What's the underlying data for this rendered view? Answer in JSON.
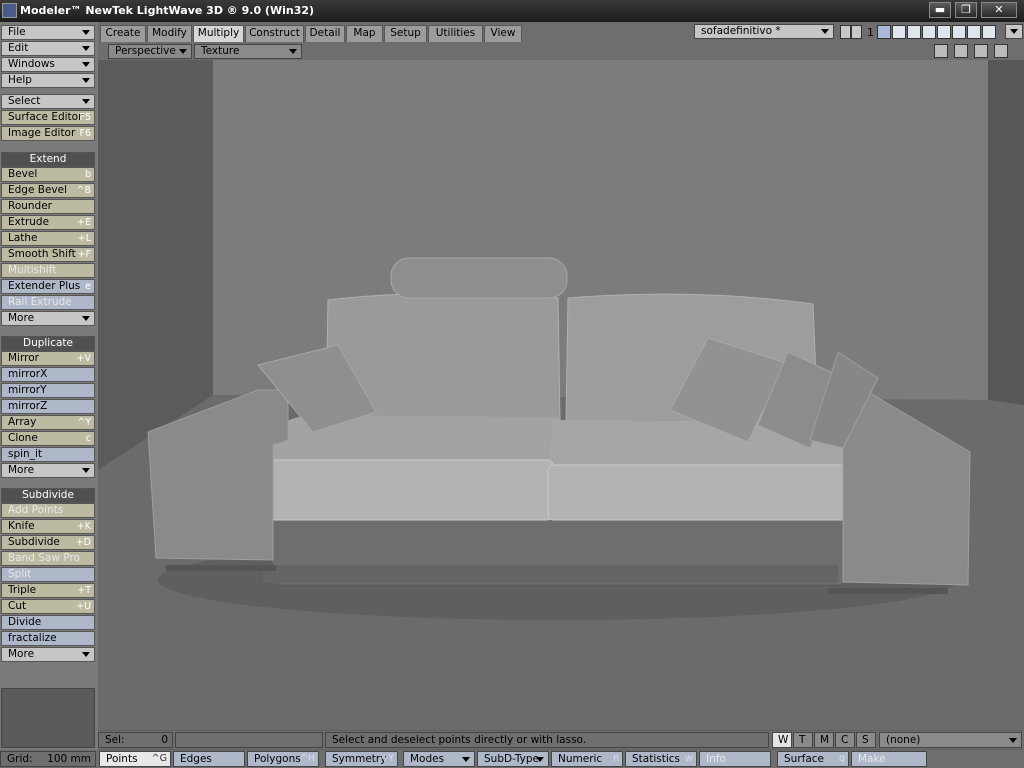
{
  "title": {
    "text": "Modeler™ NewTek LightWave 3D ® 9.0 (Win32)",
    "min": "▬",
    "max": "❐",
    "close": "✕"
  },
  "menus": [
    {
      "label": "File"
    },
    {
      "label": "Edit"
    },
    {
      "label": "Windows"
    },
    {
      "label": "Help"
    }
  ],
  "quick": [
    {
      "label": "Select",
      "sc": ""
    },
    {
      "label": "Surface Editor",
      "sc": "F5"
    },
    {
      "label": "Image Editor",
      "sc": "F6"
    }
  ],
  "extend": {
    "header": "Extend",
    "items": [
      {
        "label": "Bevel",
        "sc": "b"
      },
      {
        "label": "Edge Bevel",
        "sc": "^B"
      },
      {
        "label": "Rounder",
        "sc": ""
      },
      {
        "label": "Extrude",
        "sc": "+E"
      },
      {
        "label": "Lathe",
        "sc": "+L"
      },
      {
        "label": "Smooth Shift",
        "sc": "+F"
      },
      {
        "label": "Multishift",
        "sc": ""
      },
      {
        "label": "Extender Plus",
        "sc": "e"
      },
      {
        "label": "Rail Extrude",
        "sc": ""
      },
      {
        "label": "More",
        "sc": ""
      }
    ]
  },
  "duplicate": {
    "header": "Duplicate",
    "items": [
      {
        "label": "Mirror",
        "sc": "+V"
      },
      {
        "label": "mirrorX",
        "sc": ""
      },
      {
        "label": "mirrorY",
        "sc": ""
      },
      {
        "label": "mirrorZ",
        "sc": ""
      },
      {
        "label": "Array",
        "sc": "^Y"
      },
      {
        "label": "Clone",
        "sc": "c"
      },
      {
        "label": "spin_it",
        "sc": ""
      },
      {
        "label": "More",
        "sc": ""
      }
    ]
  },
  "subdivide": {
    "header": "Subdivide",
    "items": [
      {
        "label": "Add Points",
        "sc": ""
      },
      {
        "label": "Knife",
        "sc": "+K"
      },
      {
        "label": "Subdivide",
        "sc": "+D"
      },
      {
        "label": "Band Saw Pro",
        "sc": ""
      },
      {
        "label": "Split",
        "sc": ""
      },
      {
        "label": "Triple",
        "sc": "+T"
      },
      {
        "label": "Cut",
        "sc": "+U"
      },
      {
        "label": "Divide",
        "sc": ""
      },
      {
        "label": "fractalize",
        "sc": ""
      },
      {
        "label": "More",
        "sc": ""
      }
    ]
  },
  "tabs": [
    {
      "label": "Create"
    },
    {
      "label": "Modify"
    },
    {
      "label": "Multiply"
    },
    {
      "label": "Construct"
    },
    {
      "label": "Detail"
    },
    {
      "label": "Map"
    },
    {
      "label": "Setup"
    },
    {
      "label": "Utilities"
    },
    {
      "label": "View"
    }
  ],
  "object": {
    "name": "sofadefinitivo *",
    "layer": "1"
  },
  "view": {
    "mode": "Perspective",
    "shading": "Texture"
  },
  "status": {
    "sel_label": "Sel:",
    "sel_value": "0",
    "message": "Select and deselect points directly or with lasso.",
    "wtmcs": [
      "W",
      "T",
      "M",
      "C",
      "S"
    ],
    "vmap": "(none)"
  },
  "grid": {
    "label": "Grid:",
    "value": "100 mm"
  },
  "bottombar": [
    {
      "label": "Points",
      "sc": "^G"
    },
    {
      "label": "Edges",
      "sc": ""
    },
    {
      "label": "Polygons",
      "sc": "^H"
    },
    {
      "label": "Symmetry",
      "sc": "+Y"
    },
    {
      "label": "Modes",
      "sc": ""
    },
    {
      "label": "SubD-Type",
      "sc": ""
    },
    {
      "label": "Numeric",
      "sc": "n"
    },
    {
      "label": "Statistics",
      "sc": "w"
    },
    {
      "label": "Info",
      "sc": ""
    },
    {
      "label": "Surface",
      "sc": "q"
    },
    {
      "label": "Make",
      "sc": ""
    }
  ],
  "colors": {
    "panel": "#7a7a7a",
    "button": "#c6c6c6",
    "tan": "#bdbaa2",
    "blue": "#aeb8c8",
    "header": "#505050",
    "viewport": "#6a6a6a"
  }
}
